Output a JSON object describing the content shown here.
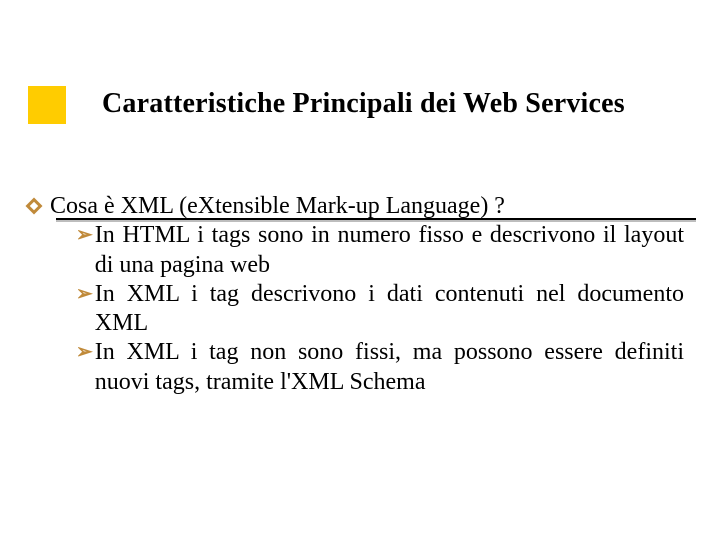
{
  "slide": {
    "title": "Caratteristiche Principali dei Web Services",
    "colors": {
      "accent_square": "#ffcc00",
      "bullet": "#c08a3a"
    },
    "level1": {
      "text": "Cosa è XML (eXtensible Mark-up Language) ?"
    },
    "level2": [
      {
        "text": "In HTML i tags sono in numero fisso e descrivono il layout di una pagina web"
      },
      {
        "text": "In XML i tag descrivono i dati contenuti nel documento XML"
      },
      {
        "text": "In XML i tag non sono fissi, ma possono essere definiti nuovi tags, tramite l'XML Schema"
      }
    ]
  }
}
